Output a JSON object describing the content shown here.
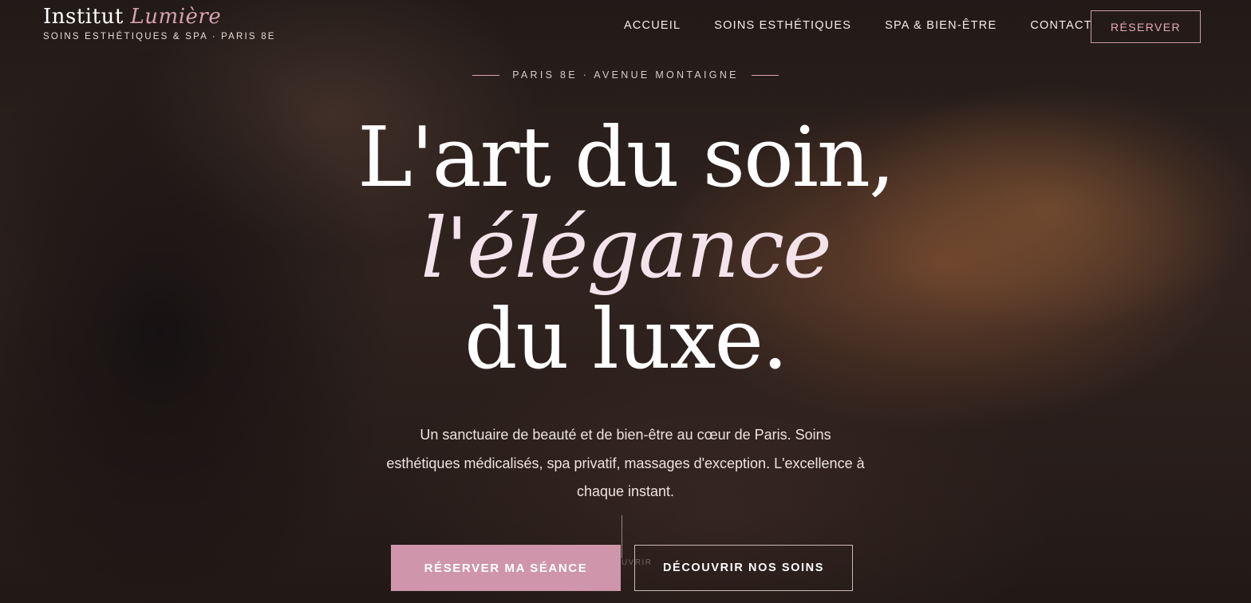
{
  "brand": {
    "name_main": "Institut",
    "name_accent": "Lumière",
    "tagline": "SOINS ESTHÉTIQUES & SPA · PARIS 8E"
  },
  "nav": {
    "items": [
      {
        "label": "ACCUEIL"
      },
      {
        "label": "SOINS ESTHÉTIQUES"
      },
      {
        "label": "SPA & BIEN-ÊTRE"
      },
      {
        "label": "CONTACT"
      }
    ],
    "reserve_label": "RÉSERVER"
  },
  "hero": {
    "eyebrow": "PARIS 8E · AVENUE MONTAIGNE",
    "title_line1": "L'art du soin,",
    "title_line2": "l'élégance",
    "title_line3": "du luxe.",
    "subtitle": "Un sanctuaire de beauté et de bien-être au cœur de Paris. Soins esthétiques médicalisés, spa privatif, massages d'exception. L'excellence à chaque instant.",
    "primary_cta": "RÉSERVER MA SÉANCE",
    "secondary_cta": "DÉCOUVRIR NOS SOINS",
    "scroll_label": "DÉCOUVRIR"
  },
  "colors": {
    "accent_pink": "#cf96ab",
    "accent_pink_text": "#d7a0b2"
  }
}
